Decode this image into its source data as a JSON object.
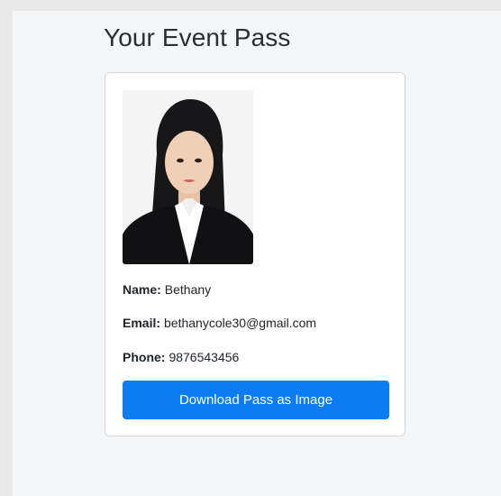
{
  "page": {
    "title": "Your Event Pass"
  },
  "pass": {
    "name_label": "Name:",
    "name_value": "Bethany",
    "email_label": "Email:",
    "email_value": "bethanycole30@gmail.com",
    "phone_label": "Phone:",
    "phone_value": "9876543456",
    "download_button_label": "Download Pass as Image",
    "photo_icon": "person-photo"
  },
  "colors": {
    "accent": "#0d7cf2",
    "background": "#f5f6f8",
    "card": "#ffffff"
  }
}
